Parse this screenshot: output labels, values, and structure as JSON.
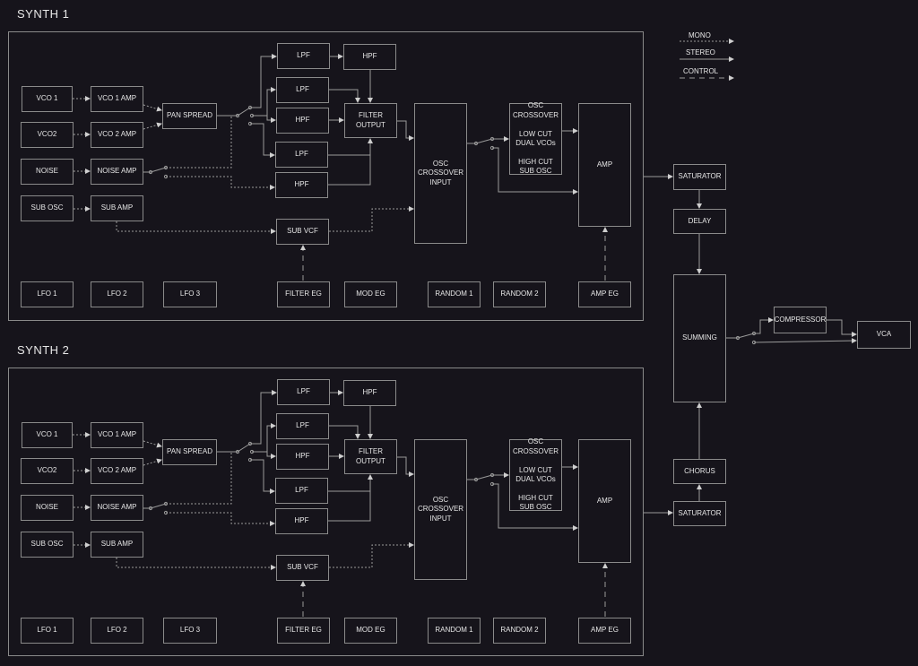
{
  "synth1": {
    "title": "SYNTH  1",
    "vco1": "VCO 1",
    "vco2": "VCO2",
    "noise": "NOISE",
    "sub_osc": "SUB OSC",
    "vco1_amp": "VCO 1 AMP",
    "vco2_amp": "VCO 2 AMP",
    "noise_amp": "NOISE AMP",
    "sub_amp": "SUB AMP",
    "pan_spread": "PAN SPREAD",
    "lpf_a": "LPF",
    "hpf_a": "HPF",
    "lpf_b": "LPF",
    "hpf_b": "HPF",
    "lpf_c": "LPF",
    "hpf_c": "HPF",
    "filter_output": "FILTER\nOUTPUT",
    "sub_vcf": "SUB VCF",
    "osc_crossover_input": "OSC\nCROSSOVER\nINPUT",
    "osc_crossover": "OSC\nCROSSOVER\n\nLOW CUT\nDUAL VCOs\n\nHIGH CUT\nSUB OSC",
    "amp": "AMP",
    "lfo1": "LFO 1",
    "lfo2": "LFO 2",
    "lfo3": "LFO 3",
    "filter_eg": "FILTER EG",
    "mod_eg": "MOD EG",
    "random1": "RANDOM 1",
    "random2": "RANDOM 2",
    "amp_eg": "AMP EG"
  },
  "synth2": {
    "title": "SYNTH  2",
    "vco1": "VCO 1",
    "vco2": "VCO2",
    "noise": "NOISE",
    "sub_osc": "SUB OSC",
    "vco1_amp": "VCO 1 AMP",
    "vco2_amp": "VCO 2 AMP",
    "noise_amp": "NOISE AMP",
    "sub_amp": "SUB AMP",
    "pan_spread": "PAN SPREAD",
    "lpf_a": "LPF",
    "hpf_a": "HPF",
    "lpf_b": "LPF",
    "hpf_b": "HPF",
    "lpf_c": "LPF",
    "hpf_c": "HPF",
    "filter_output": "FILTER\nOUTPUT",
    "sub_vcf": "SUB VCF",
    "osc_crossover_input": "OSC\nCROSSOVER\nINPUT",
    "osc_crossover": "OSC\nCROSSOVER\n\nLOW CUT\nDUAL VCOs\n\nHIGH CUT\nSUB OSC",
    "amp": "AMP",
    "lfo1": "LFO 1",
    "lfo2": "LFO 2",
    "lfo3": "LFO 3",
    "filter_eg": "FILTER EG",
    "mod_eg": "MOD EG",
    "random1": "RANDOM 1",
    "random2": "RANDOM 2",
    "amp_eg": "AMP EG"
  },
  "master": {
    "saturator1": "SATURATOR",
    "delay": "DELAY",
    "summing": "SUMMING",
    "chorus": "CHORUS",
    "saturator2": "SATURATOR",
    "compressor": "COMPRESSOR",
    "vca": "VCA"
  },
  "legend": {
    "mono": "MONO",
    "stereo": "STEREO",
    "control": "CONTROL"
  },
  "colors": {
    "background": "#16141b",
    "stroke": "#8a8a8a",
    "text": "#e6e6e6"
  }
}
